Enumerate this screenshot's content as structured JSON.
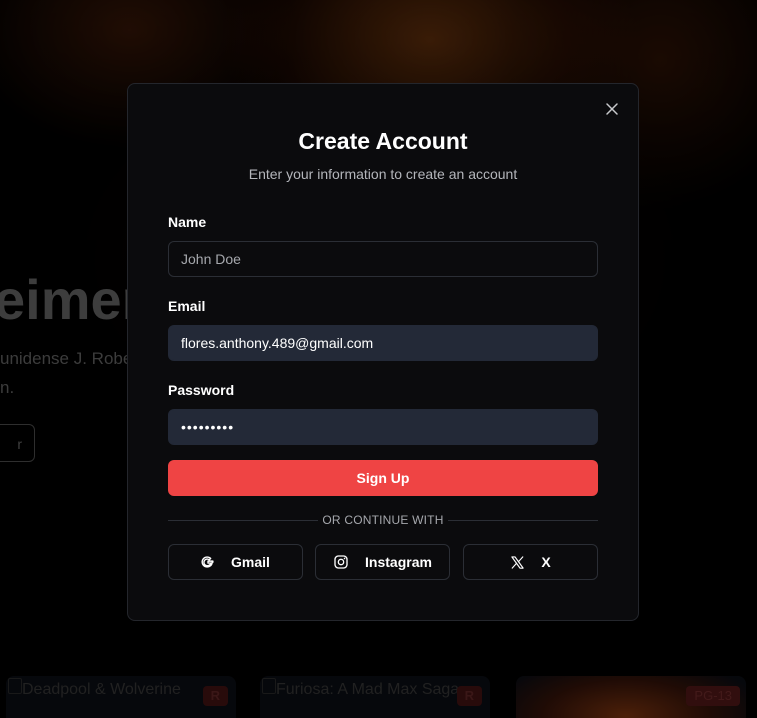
{
  "hero": {
    "title": "eimer",
    "description_line1": "unidense J. Robe",
    "description_line2": "n.",
    "button_label": "r"
  },
  "movies": [
    {
      "title": "Deadpool & Wolverine",
      "rating": "R"
    },
    {
      "title": "Furiosa: A Mad Max Saga",
      "rating": "R"
    },
    {
      "title": "",
      "rating": "PG-13"
    }
  ],
  "modal": {
    "title": "Create Account",
    "subtitle": "Enter your information to create an account",
    "close_icon": "close-icon",
    "fields": {
      "name": {
        "label": "Name",
        "value": "",
        "placeholder": "John Doe"
      },
      "email": {
        "label": "Email",
        "value": "flores.anthony.489@gmail.com",
        "placeholder": ""
      },
      "password": {
        "label": "Password",
        "value": "•••••••••",
        "placeholder": ""
      }
    },
    "submit_label": "Sign Up",
    "divider_text": "OR CONTINUE WITH",
    "social": [
      {
        "label": "Gmail",
        "icon": "google-icon"
      },
      {
        "label": "Instagram",
        "icon": "instagram-icon"
      },
      {
        "label": "X",
        "icon": "x-logo-icon"
      }
    ]
  },
  "colors": {
    "accent": "#ef4444",
    "modal_bg": "#0b0b0d",
    "filled_input_bg": "#232937",
    "border": "#2b2e35"
  }
}
